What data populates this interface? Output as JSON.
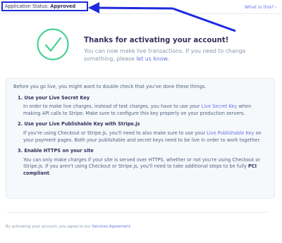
{
  "header": {
    "status_label": "Application Status:",
    "status_value": "Approved",
    "help_link": "What is this?",
    "help_chevron": "›"
  },
  "hero": {
    "icon": "checkmark-circle-icon",
    "accent_color": "#3ecf8e",
    "title": "Thanks for activating your account!",
    "subtitle_before": "You can now make live transactions. If you need to change something, please ",
    "subtitle_link": "let us know",
    "subtitle_after": "."
  },
  "annotation": {
    "arrow_color": "#1f2bdc"
  },
  "checklist": {
    "intro": "Before you go live, you might want to double check that you've done these things.",
    "items": [
      {
        "title": "1. Use your Live Secret Key",
        "text_before": "In order to make live charges, instead of test charges, you have to use your ",
        "link": "Live Secret Key",
        "text_after": " when making API calls to Stripe. Make sure to configure this key properly on your production servers."
      },
      {
        "title": "2. Use your Live Publishable Key with Stripe.js",
        "text_before": "If you're using Checkout or Stripe.js, you'll need to also make sure to use your ",
        "link": "Live Publishable Key",
        "text_after": " on your payment pages. Both your publishable and secret keys need to be live in order to work together."
      },
      {
        "title": "3. Enable HTTPS on your site",
        "text_before": "You can only make charges if your site is served over HTTPS, whether or not you're using Checkout or Stripe.js. If you aren't using Checkout or Stripe.js, you'll need to take additional steps to be fully ",
        "bold": "PCI compliant",
        "text_after": "."
      }
    ]
  },
  "footer": {
    "text_before": "By activating your account, you agree to our ",
    "link": "Services Agreement",
    "text_after": "."
  }
}
